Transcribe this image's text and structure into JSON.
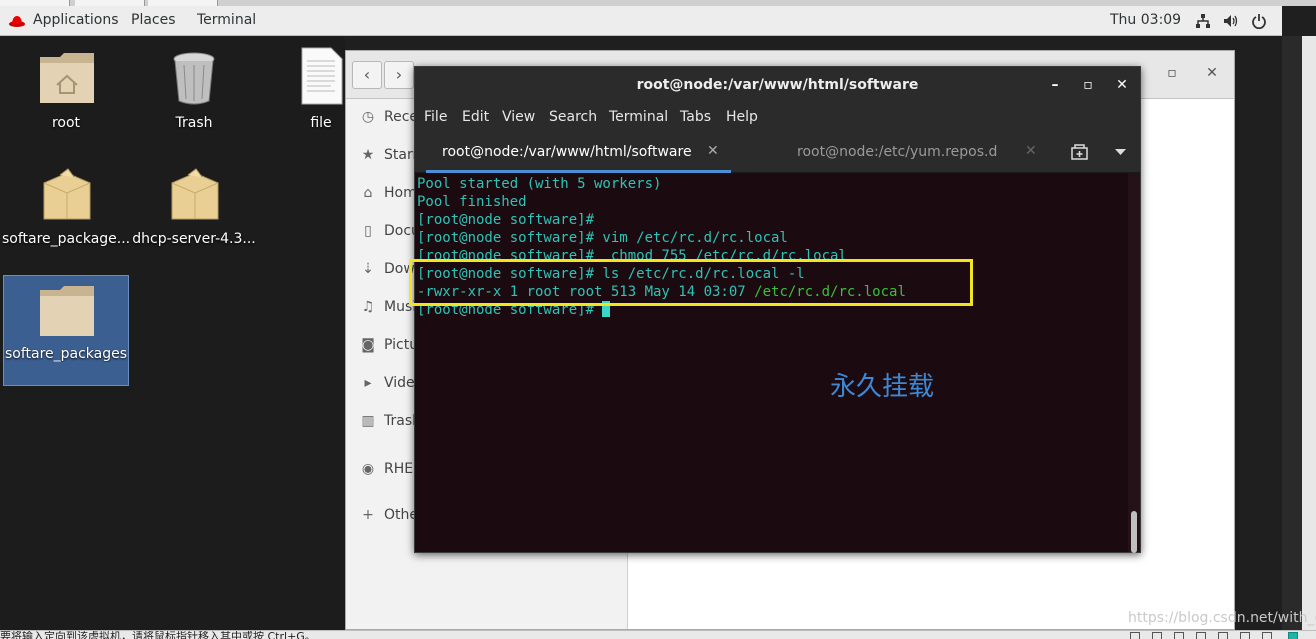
{
  "topbar": {
    "applications": "Applications",
    "places": "Places",
    "terminal": "Terminal",
    "clock": "Thu 03:09",
    "icons": [
      "network-icon",
      "volume-icon",
      "power-icon"
    ]
  },
  "desktop": {
    "icons": [
      {
        "label": "root",
        "icon": "home-folder-icon"
      },
      {
        "label": "Trash",
        "icon": "trash-icon"
      },
      {
        "label": "file",
        "icon": "text-file-icon"
      },
      {
        "label": "softare_package...",
        "icon": "package-icon"
      },
      {
        "label": "dhcp-server-4.3...",
        "icon": "package-icon"
      },
      {
        "label": "softare_packages",
        "icon": "folder-icon"
      }
    ]
  },
  "files": {
    "sidebar": [
      {
        "label": "Rece",
        "icon": "clock-icon"
      },
      {
        "label": "Starr",
        "icon": "star-icon"
      },
      {
        "label": "Hom",
        "icon": "home-icon"
      },
      {
        "label": "Docu",
        "icon": "document-icon"
      },
      {
        "label": "Dow",
        "icon": "download-icon"
      },
      {
        "label": "Musi",
        "icon": "music-icon"
      },
      {
        "label": "Pictu",
        "icon": "camera-icon"
      },
      {
        "label": "Vide",
        "icon": "video-icon"
      },
      {
        "label": "Trash",
        "icon": "trash-icon"
      },
      {
        "label": "RHEL",
        "icon": "disc-icon"
      },
      {
        "label": "Othe",
        "icon": "plus-icon"
      }
    ]
  },
  "terminal": {
    "title": "root@node:/var/www/html/software",
    "menu": [
      "File",
      "Edit",
      "View",
      "Search",
      "Terminal",
      "Tabs",
      "Help"
    ],
    "tabs": [
      {
        "label": "root@node:/var/www/html/software",
        "active": true
      },
      {
        "label": "root@node:/etc/yum.repos.d",
        "active": false
      }
    ],
    "lines": [
      "Pool started (with 5 workers)",
      "Pool finished",
      "[root@node software]#",
      "[root@node software]# vim /etc/rc.d/rc.local",
      "[root@node software]#  chmod 755 /etc/rc.d/rc.local",
      "[root@node software]# ls /etc/rc.d/rc.local -l"
    ],
    "ls_line": {
      "prefix": "-rwxr-xr-x 1 root root 513 May 14 03:07 ",
      "path": "/etc/rc.d/rc.local"
    },
    "prompt": "[root@node software]# "
  },
  "annotation": "永久挂载",
  "status": {
    "text": "要将输入定向到该虚拟机，请将鼠标指针移入其中或按 Ctrl+G。",
    "watermark": "https://blog.csdn.net/with_cat"
  }
}
